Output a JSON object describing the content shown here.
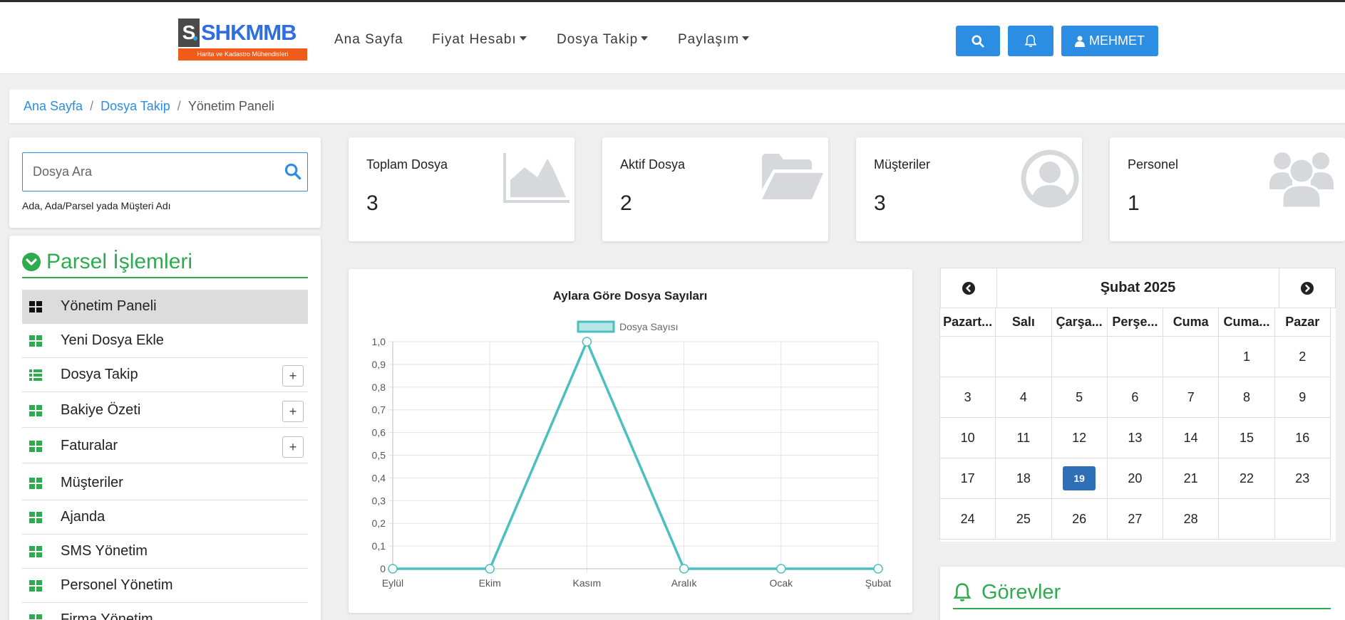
{
  "brand": {
    "letter": "S",
    "name": "SHKMMB",
    "tagline": "Harita ve Kadastro Mühendisleri",
    "accent": "#2f6ee0",
    "tagline_bg": "#f05a1a"
  },
  "nav": {
    "home": "Ana Sayfa",
    "price": "Fiyat Hesabı",
    "files": "Dosya Takip",
    "share": "Paylaşım",
    "user": "MEHMET",
    "search_icon": "search-icon",
    "bell_icon": "bell-icon"
  },
  "breadcrumb": {
    "items": [
      "Ana Sayfa",
      "Dosya Takip"
    ],
    "current": "Yönetim Paneli"
  },
  "search": {
    "placeholder": "Dosya Ara",
    "help": "Ada, Ada/Parsel yada Müşteri Adı"
  },
  "menu": {
    "title": "Parsel İşlemleri",
    "items": [
      {
        "label": "Yönetim Paneli",
        "icon": "grid-icon",
        "active": true,
        "expandable": false
      },
      {
        "label": "Yeni Dosya Ekle",
        "icon": "grid-icon",
        "active": false,
        "expandable": false
      },
      {
        "label": "Dosya Takip",
        "icon": "list-icon",
        "active": false,
        "expandable": true
      },
      {
        "label": "Bakiye Özeti",
        "icon": "grid-icon",
        "active": false,
        "expandable": true
      },
      {
        "label": "Faturalar",
        "icon": "grid-icon",
        "active": false,
        "expandable": true
      },
      {
        "label": "Müşteriler",
        "icon": "grid-icon",
        "active": false,
        "expandable": false
      },
      {
        "label": "Ajanda",
        "icon": "grid-icon",
        "active": false,
        "expandable": false
      },
      {
        "label": "SMS Yönetim",
        "icon": "grid-icon",
        "active": false,
        "expandable": false
      },
      {
        "label": "Personel Yönetim",
        "icon": "grid-icon",
        "active": false,
        "expandable": false
      },
      {
        "label": "Firma Yönetim",
        "icon": "grid-icon",
        "active": false,
        "expandable": false
      }
    ],
    "plus": "+"
  },
  "stats": [
    {
      "label": "Toplam Dosya",
      "value": "3",
      "icon": "area-chart-icon"
    },
    {
      "label": "Aktif Dosya",
      "value": "2",
      "icon": "folder-open-icon"
    },
    {
      "label": "Müşteriler",
      "value": "3",
      "icon": "user-circle-icon"
    },
    {
      "label": "Personel",
      "value": "1",
      "icon": "users-icon"
    }
  ],
  "chart_data": {
    "type": "line",
    "title": "Aylara Göre Dosya Sayıları",
    "categories": [
      "Eylül",
      "Ekim",
      "Kasım",
      "Aralık",
      "Ocak",
      "Şubat"
    ],
    "series": [
      {
        "name": "Dosya Sayısı",
        "values": [
          0,
          0,
          1,
          0,
          0,
          0
        ],
        "color": "#4bc0c0"
      }
    ],
    "ylim": [
      0,
      1
    ],
    "yticks": [
      "1,0",
      "0,9",
      "0,8",
      "0,7",
      "0,6",
      "0,5",
      "0,4",
      "0,3",
      "0,2",
      "0,1",
      "0"
    ],
    "grid": true,
    "legend": "top"
  },
  "calendar": {
    "title": "Şubat 2025",
    "dows": [
      "Pazart...",
      "Salı",
      "Çarşa...",
      "Perşe...",
      "Cuma",
      "Cuma...",
      "Pazar"
    ],
    "weeks": [
      [
        "",
        "",
        "",
        "",
        "",
        "1",
        "2"
      ],
      [
        "3",
        "4",
        "5",
        "6",
        "7",
        "8",
        "9"
      ],
      [
        "10",
        "11",
        "12",
        "13",
        "14",
        "15",
        "16"
      ],
      [
        "17",
        "18",
        "19",
        "20",
        "21",
        "22",
        "23"
      ],
      [
        "24",
        "25",
        "26",
        "27",
        "28",
        "",
        ""
      ]
    ],
    "today": "19"
  },
  "tasks": {
    "title": "Görevler"
  }
}
